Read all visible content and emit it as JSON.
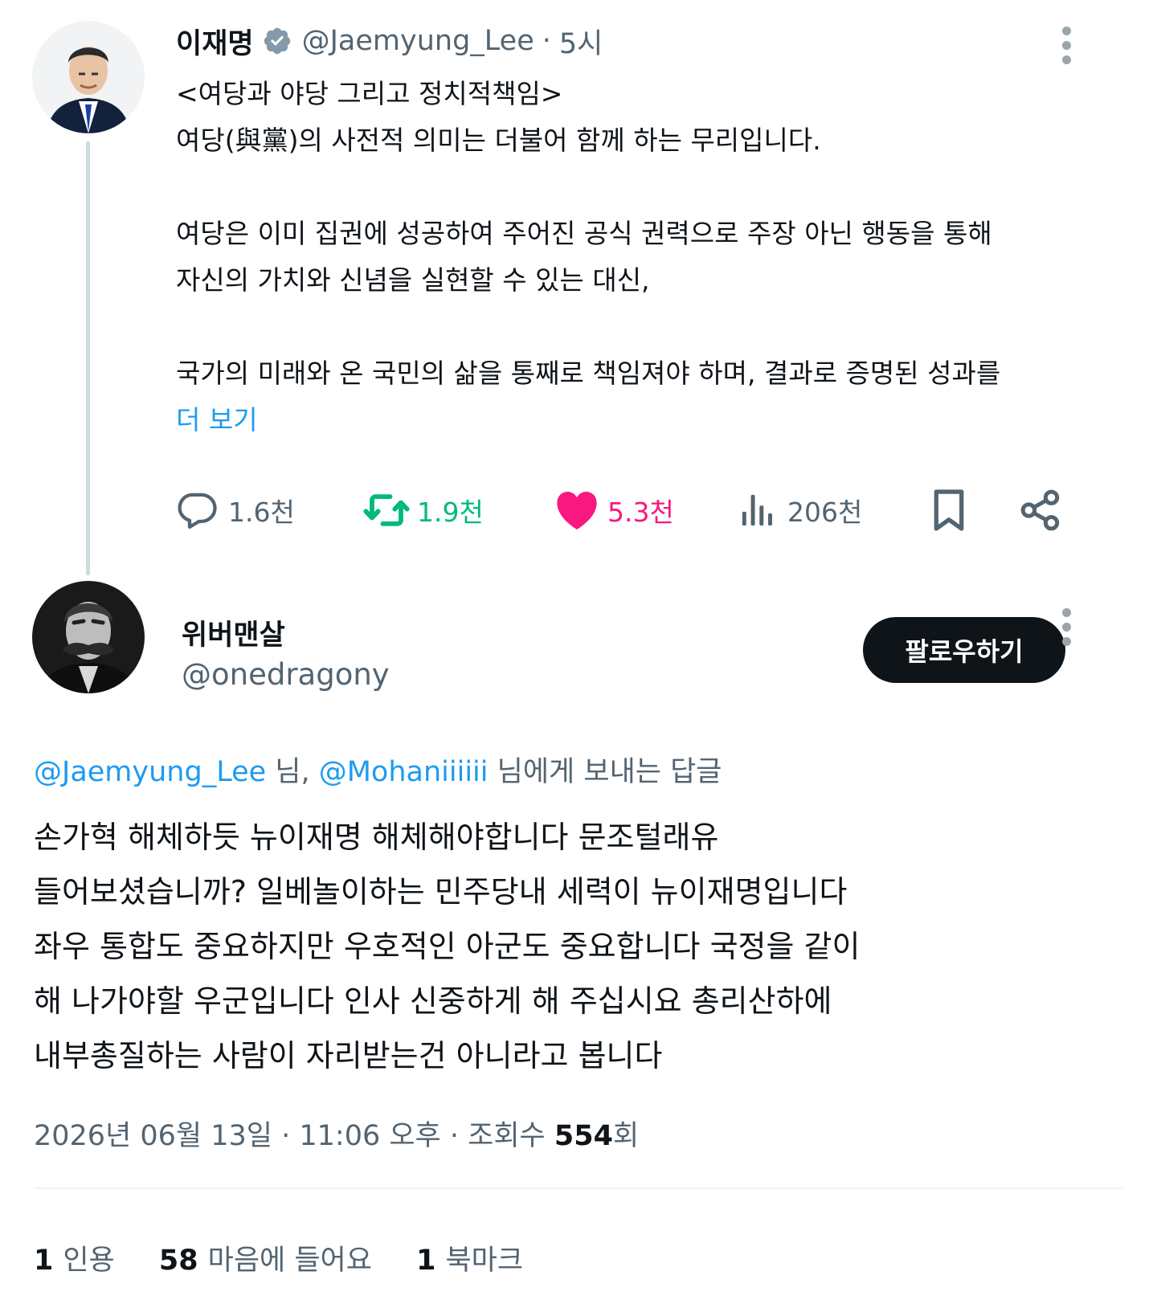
{
  "parent_tweet": {
    "author_name": "이재명",
    "handle": "@Jaemyung_Lee",
    "separator": "·",
    "time": "5시",
    "lines": [
      "<여당과 야당 그리고 정치적책임>",
      "여당(與黨)의 사전적 의미는 더불어 함께 하는 무리입니다.",
      "",
      "여당은 이미 집권에 성공하여 주어진 공식 권력으로 주장 아닌 행동을 통해",
      "자신의 가치와 신념을 실현할 수 있는 대신,",
      "",
      "국가의 미래와 온 국민의 삶을 통째로 책임져야 하며, 결과로 증명된 성과를"
    ],
    "show_more": "더 보기",
    "actions": {
      "replies": "1.6천",
      "reposts": "1.9천",
      "likes": "5.3천",
      "views": "206천"
    },
    "colors": {
      "repost": "#00ba7c",
      "like": "#f91880",
      "muted": "#536471"
    }
  },
  "reply_tweet": {
    "author_name": "위버맨살",
    "handle": "@onedragony",
    "follow_label": "팔로우하기",
    "reply_to": {
      "mention1": "@Jaemyung_Lee",
      "text1": " 님, ",
      "mention2": "@Mohaniiiiii",
      "text2": " 님에게 보내는 답글"
    },
    "lines": [
      "손가혁 해체하듯 뉴이재명 해체해야합니다 문조털래유",
      "들어보셨습니까? 일베놀이하는 민주당내 세력이 뉴이재명입니다",
      "좌우 통합도 중요하지만 우호적인 아군도 중요합니다 국정을 같이",
      "해 나가야할 우군입니다 인사 신중하게 해 주십시요 총리산하에",
      "내부총질하는 사람이 자리받는건 아니라고 봅니다"
    ],
    "meta": {
      "datetime": "2026년 06월 13일 · 11:06 오후 · 조회수 ",
      "views_num": "554",
      "views_unit": "회"
    },
    "stats": {
      "quotes_num": "1",
      "quotes_label": "인용",
      "likes_num": "58",
      "likes_label": "마음에 들어요",
      "bookmarks_num": "1",
      "bookmarks_label": "북마크"
    }
  },
  "icons": {
    "verified": "verified-badge-icon",
    "more": "more-vertical-icon",
    "reply": "reply-bubble-icon",
    "repost": "repost-icon",
    "like": "heart-icon",
    "views": "views-bar-chart-icon",
    "bookmark": "bookmark-icon",
    "share": "share-icon"
  }
}
